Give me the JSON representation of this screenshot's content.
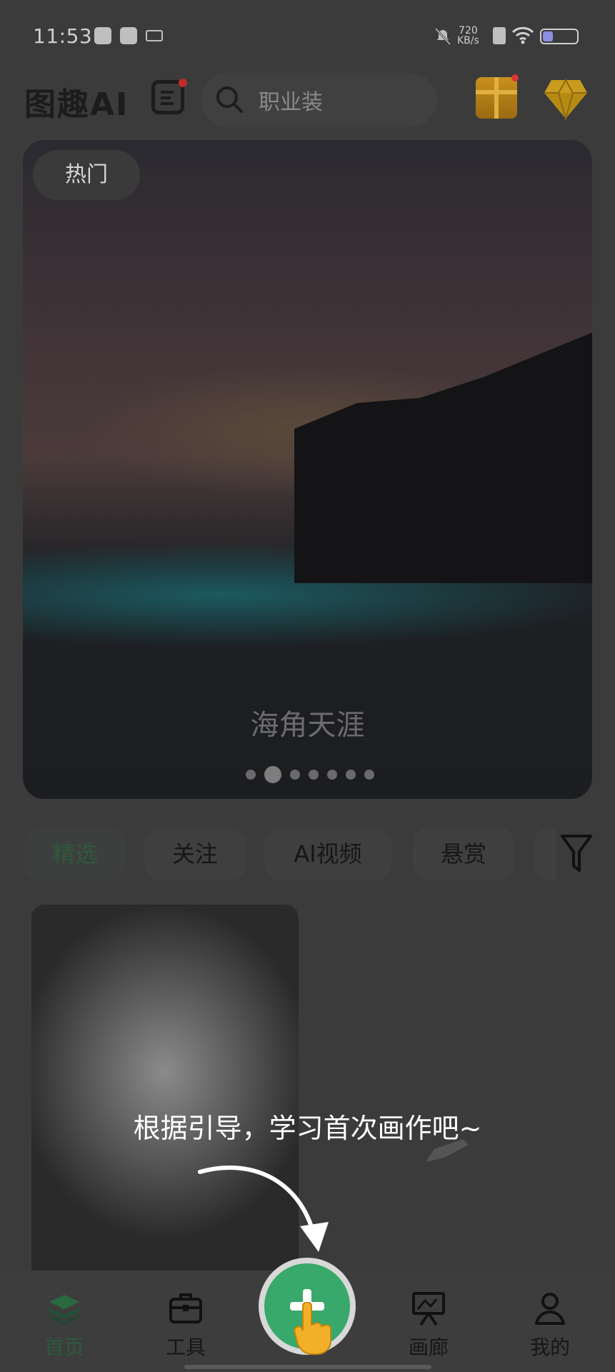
{
  "status_bar": {
    "time": "11:53",
    "net_speed_value": "720",
    "net_speed_unit": "KB/s",
    "battery_level": 0.3
  },
  "header": {
    "logo": "图趣AI",
    "search_placeholder": "职业装"
  },
  "banner": {
    "tag": "热门",
    "title": "海角天涯",
    "page_count": 7,
    "active_index": 1
  },
  "tabs": [
    {
      "label": "精选",
      "selected": true
    },
    {
      "label": "关注",
      "selected": false
    },
    {
      "label": "AI视频",
      "selected": false
    },
    {
      "label": "悬赏",
      "selected": false
    }
  ],
  "guide": {
    "text": "根据引导，学习首次画作吧~"
  },
  "nav": {
    "home": "首页",
    "tools": "工具",
    "gallery": "画廊",
    "mine": "我的"
  },
  "colors": {
    "accent": "#38a86b",
    "selected_text": "#2d5a3c",
    "overlay": "#3b3b3b"
  },
  "icons": [
    "search-icon",
    "gift-icon",
    "diamond-icon",
    "filter-icon",
    "layers-icon",
    "toolbox-icon",
    "easel-icon",
    "user-icon",
    "plus-icon",
    "hand-pointer-icon"
  ]
}
